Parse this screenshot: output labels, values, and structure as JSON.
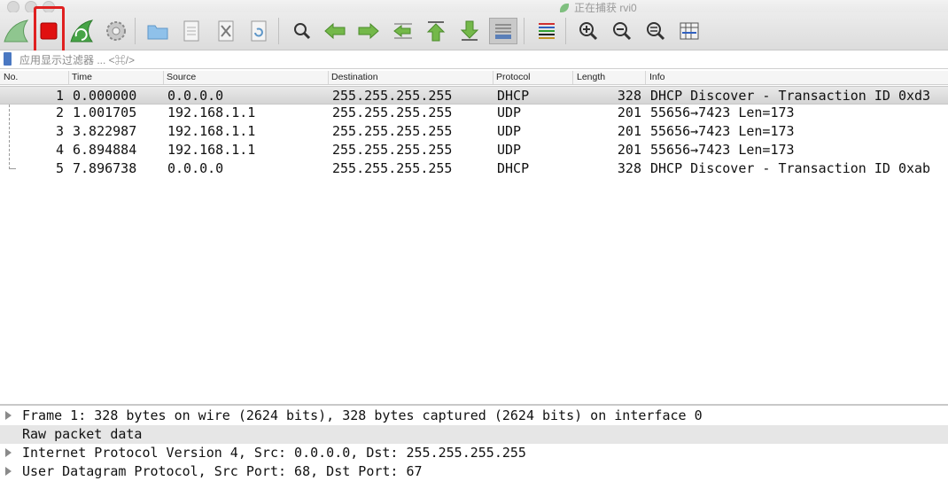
{
  "window": {
    "title": "正在捕获 rvi0"
  },
  "toolbar": {
    "buttons": [
      {
        "name": "start-capture-button",
        "icon": "shark-fin-icon"
      },
      {
        "name": "stop-capture-button",
        "icon": "stop-square-icon"
      },
      {
        "name": "restart-capture-button",
        "icon": "restart-fin-icon"
      },
      {
        "name": "capture-options-button",
        "icon": "gear-icon"
      },
      {
        "name": "open-file-button",
        "icon": "folder-icon"
      },
      {
        "name": "save-file-button",
        "icon": "save-file-icon"
      },
      {
        "name": "close-file-button",
        "icon": "close-file-icon"
      },
      {
        "name": "reload-file-button",
        "icon": "reload-icon"
      },
      {
        "name": "find-packet-button",
        "icon": "magnifier-icon"
      },
      {
        "name": "go-back-button",
        "icon": "arrow-left-icon"
      },
      {
        "name": "go-forward-button",
        "icon": "arrow-right-icon"
      },
      {
        "name": "go-to-packet-button",
        "icon": "goto-packet-icon"
      },
      {
        "name": "first-packet-button",
        "icon": "arrow-up-icon"
      },
      {
        "name": "last-packet-button",
        "icon": "arrow-down-icon"
      },
      {
        "name": "autoscroll-button",
        "icon": "autoscroll-icon"
      },
      {
        "name": "colorize-button",
        "icon": "colorize-lines-icon"
      },
      {
        "name": "zoom-in-button",
        "icon": "zoom-in-icon"
      },
      {
        "name": "zoom-out-button",
        "icon": "zoom-out-icon"
      },
      {
        "name": "normal-size-button",
        "icon": "zoom-reset-icon"
      },
      {
        "name": "resize-columns-button",
        "icon": "resize-columns-icon"
      }
    ],
    "accent_stop": "#e01010"
  },
  "filter": {
    "placeholder": "应用显示过滤器 ... <⌘/>"
  },
  "columns": [
    "No.",
    "Time",
    "Source",
    "Destination",
    "Protocol",
    "Length",
    "Info"
  ],
  "packets": [
    {
      "no": "1",
      "time": "0.000000",
      "source": "0.0.0.0",
      "destination": "255.255.255.255",
      "protocol": "DHCP",
      "length": "328",
      "info": "DHCP Discover - Transaction ID 0xd3"
    },
    {
      "no": "2",
      "time": "1.001705",
      "source": "192.168.1.1",
      "destination": "255.255.255.255",
      "protocol": "UDP",
      "length": "201",
      "info": "55656→7423 Len=173"
    },
    {
      "no": "3",
      "time": "3.822987",
      "source": "192.168.1.1",
      "destination": "255.255.255.255",
      "protocol": "UDP",
      "length": "201",
      "info": "55656→7423 Len=173"
    },
    {
      "no": "4",
      "time": "6.894884",
      "source": "192.168.1.1",
      "destination": "255.255.255.255",
      "protocol": "UDP",
      "length": "201",
      "info": "55656→7423 Len=173"
    },
    {
      "no": "5",
      "time": "7.896738",
      "source": "0.0.0.0",
      "destination": "255.255.255.255",
      "protocol": "DHCP",
      "length": "328",
      "info": "DHCP Discover - Transaction ID 0xab"
    }
  ],
  "details": [
    {
      "text": "Frame 1: 328 bytes on wire (2624 bits), 328 bytes captured (2624 bits) on interface 0",
      "expandable": true
    },
    {
      "text": "Raw packet data",
      "expandable": false
    },
    {
      "text": "Internet Protocol Version 4, Src: 0.0.0.0, Dst: 255.255.255.255",
      "expandable": true
    },
    {
      "text": "User Datagram Protocol, Src Port: 68, Dst Port: 67",
      "expandable": true
    }
  ]
}
